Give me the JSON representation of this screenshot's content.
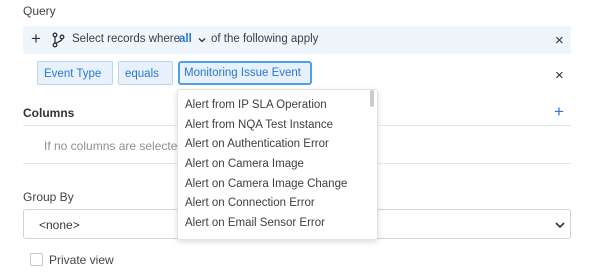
{
  "query": {
    "label": "Query",
    "header": {
      "add_icon": "plus-icon",
      "branch_icon": "branch-icon",
      "prefix": "Select records where",
      "match_mode": "all",
      "suffix": "of the following apply",
      "close_icon": "close-icon"
    },
    "condition": {
      "field": "Event Type",
      "operator": "equals",
      "value": "Monitoring Issue Event"
    },
    "dropdown_options": [
      "Alert from IP SLA Operation",
      "Alert from NQA Test Instance",
      "Alert on Authentication Error",
      "Alert on Camera Image",
      "Alert on Camera Image Change",
      "Alert on Connection Error",
      "Alert on Email Sensor Error"
    ]
  },
  "columns": {
    "label": "Columns",
    "empty_text": "If no columns are selected",
    "add_icon": "plus-icon"
  },
  "group_by": {
    "label": "Group By",
    "selected": "<none>"
  },
  "private_view": {
    "label": "Private view",
    "checked": false
  },
  "colors": {
    "accent": "#2a78d2",
    "header_bg": "#eef5fb",
    "chip_bg": "#e7f1fb",
    "focus_border": "#4fa0e6"
  }
}
